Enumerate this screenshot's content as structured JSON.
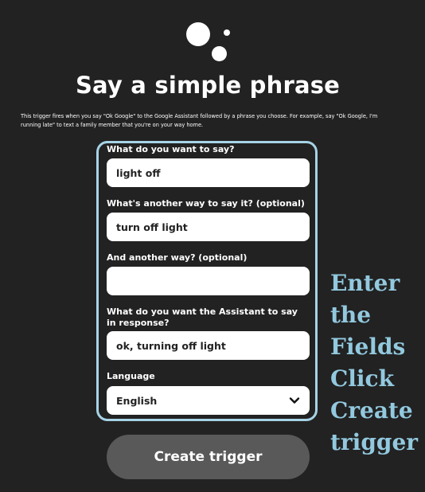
{
  "page": {
    "title": "Say a simple phrase",
    "description": "This trigger fires when you say \"Ok Google\" to the Google Assistant followed by a phrase you choose. For example, say \"Ok Google, I'm running late\" to text a family member that you're on your way home."
  },
  "form": {
    "fields": [
      {
        "label": "What do you want to say?",
        "value": "light off"
      },
      {
        "label": "What's another way to say it? (optional)",
        "value": "turn off light"
      },
      {
        "label": "And another way? (optional)",
        "value": ""
      },
      {
        "label": "What do you want the Assistant to say in response?",
        "value": "ok, turning off light"
      }
    ],
    "language": {
      "label": "Language",
      "selected": "English"
    },
    "submit_label": "Create trigger"
  },
  "annotation": {
    "lines": [
      "Enter",
      "the",
      "Fields",
      "Click",
      "Create",
      "trigger"
    ],
    "color": "#92c9df"
  },
  "colors": {
    "background": "#222222",
    "highlight_border": "#a6d3e6",
    "button": "#595959"
  },
  "icons": {
    "logo": "google-assistant-logo",
    "dropdown": "chevron-down-icon"
  }
}
